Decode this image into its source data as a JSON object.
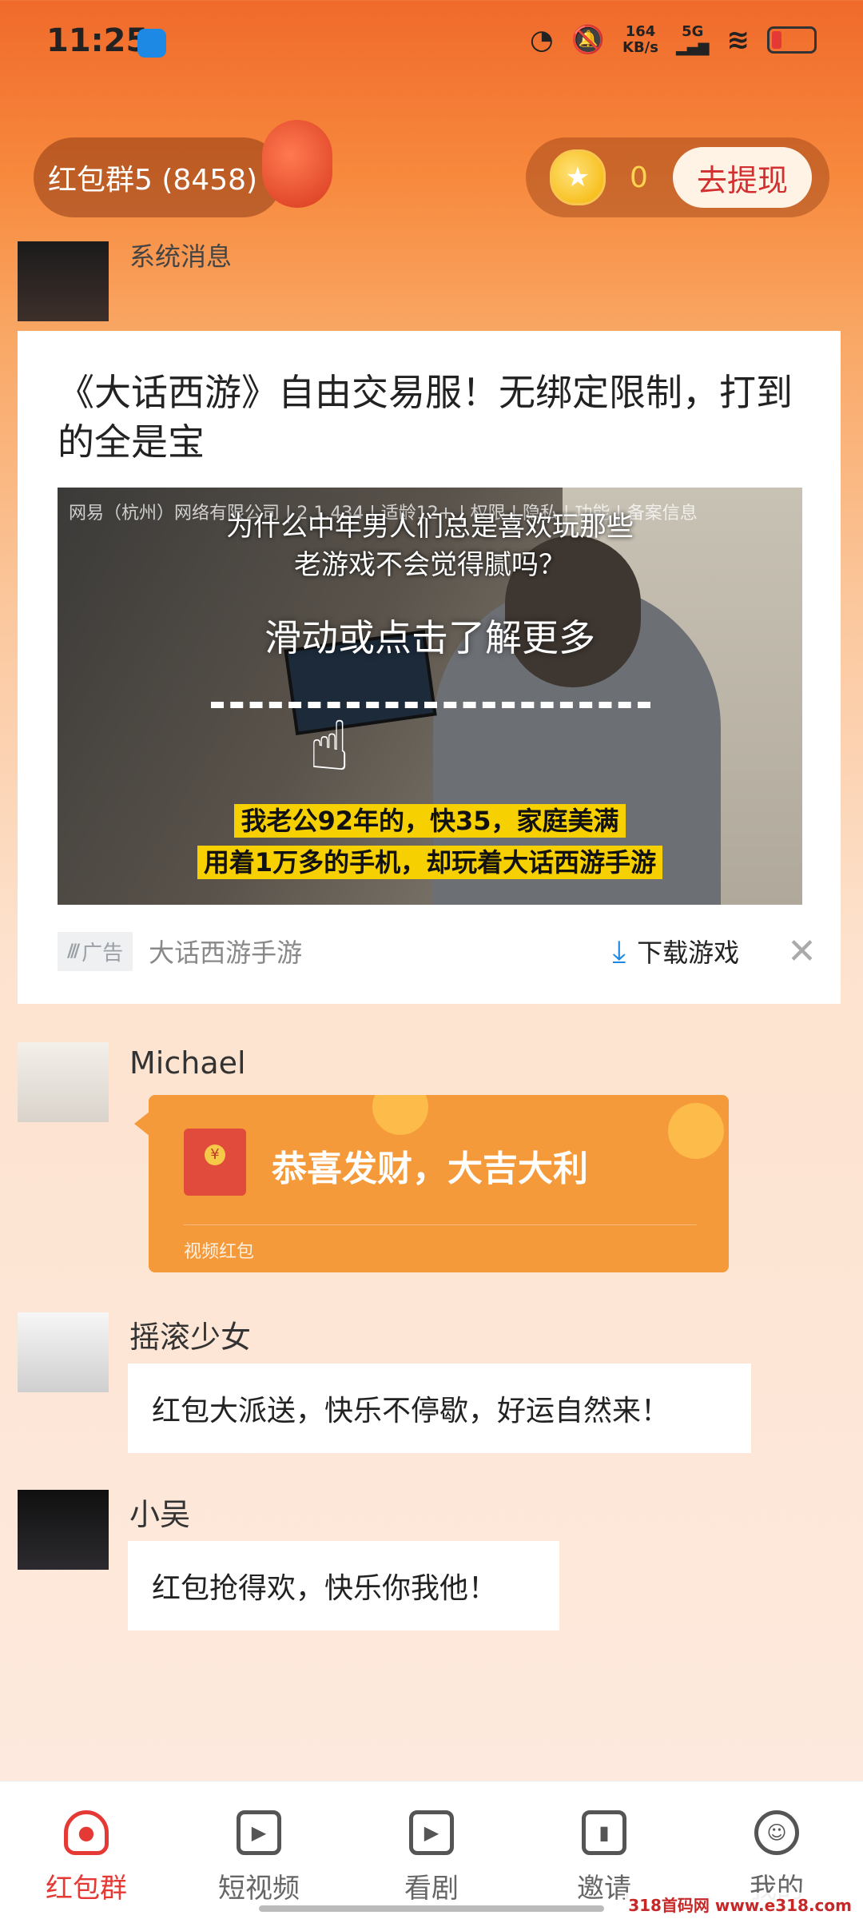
{
  "status_bar": {
    "time": "11:25",
    "net_speed_value": "164",
    "net_speed_unit": "KB/s",
    "signal_type": "5G"
  },
  "header": {
    "group_name": "红包群5 (8458)",
    "coin_count": "0",
    "withdraw_label": "去提现"
  },
  "system_message": {
    "sender": "系统消息"
  },
  "ad": {
    "title": "《大话西游》自由交易服！无绑定限制，打到的全是宝",
    "media_info": "网易（杭州）网络有限公司 | 2.1.434 | 适龄12+ | 权限 | 隐私 | 功能 | 备案信息",
    "media_question_1": "为什么中年男人们总是喜欢玩那些",
    "media_question_2": "老游戏不会觉得腻吗？",
    "media_cta": "滑动或点击了解更多",
    "media_sub_1": "我老公92年的，快35，家庭美满",
    "media_sub_2": "用着1万多的手机，却玩着大话西游手游",
    "badge": "广告",
    "source": "大话西游手游",
    "download_label": "下载游戏"
  },
  "messages": [
    {
      "sender": "Michael",
      "type": "red_packet",
      "text": "恭喜发财，大吉大利",
      "packet_label": "视频红包"
    },
    {
      "sender": "摇滚少女",
      "type": "text",
      "text": "红包大派送，快乐不停歇，好运自然来！"
    },
    {
      "sender": "小吴",
      "type": "text",
      "text": "红包抢得欢，快乐你我他！"
    }
  ],
  "bottom_nav": {
    "items": [
      {
        "label": "红包群",
        "icon": "red-packet-bag-icon",
        "active": true
      },
      {
        "label": "短视频",
        "icon": "short-video-icon",
        "active": false
      },
      {
        "label": "看剧",
        "icon": "drama-icon",
        "active": false
      },
      {
        "label": "邀请",
        "icon": "invite-chart-icon",
        "active": false
      },
      {
        "label": "我的",
        "icon": "profile-icon",
        "active": false
      }
    ]
  },
  "watermark": "318首码网 www.e318.com",
  "colors": {
    "accent": "#e53935",
    "red_packet": "#f59a3a",
    "header_orange": "#f06a2b",
    "download_blue": "#1e88e5"
  }
}
